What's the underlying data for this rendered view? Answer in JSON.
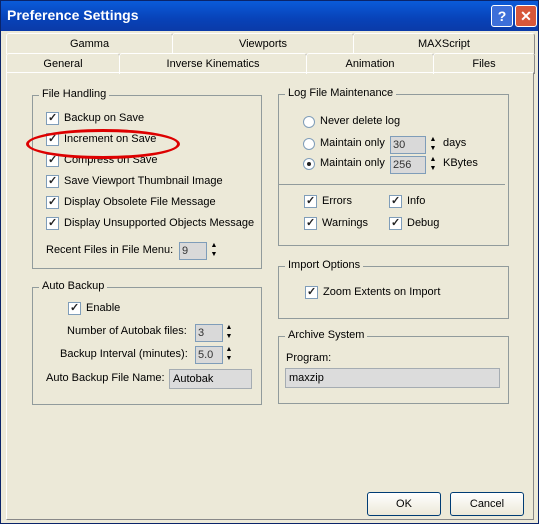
{
  "window": {
    "title": "Preference Settings"
  },
  "titlebar": {
    "help_label": "?",
    "close_label": "✕"
  },
  "tabs": {
    "row1": [
      "Gamma",
      "Viewports",
      "MAXScript"
    ],
    "row2": [
      "General",
      "Inverse Kinematics",
      "Animation",
      "Files"
    ],
    "active": "Files"
  },
  "file_handling": {
    "title": "File Handling",
    "items": [
      {
        "label": "Backup on Save",
        "checked": true
      },
      {
        "label": "Increment on Save",
        "checked": true
      },
      {
        "label": "Compress on Save",
        "checked": true
      },
      {
        "label": "Save Viewport Thumbnail Image",
        "checked": true
      },
      {
        "label": "Display Obsolete File Message",
        "checked": true
      },
      {
        "label": "Display Unsupported Objects Message",
        "checked": true
      }
    ],
    "recent_label": "Recent Files in File Menu:",
    "recent_value": "9"
  },
  "auto_backup": {
    "title": "Auto Backup",
    "enable_label": "Enable",
    "enable_checked": true,
    "num_files_label": "Number of Autobak files:",
    "num_files_value": "3",
    "interval_label": "Backup Interval (minutes):",
    "interval_value": "5.0",
    "name_label": "Auto Backup File Name:",
    "name_value": "Autobak"
  },
  "log_maintenance": {
    "title": "Log File Maintenance",
    "never_label": "Never delete log",
    "maintain_days_label": "Maintain only",
    "days_value": "30",
    "days_unit": "days",
    "maintain_kb_label": "Maintain only",
    "kb_value": "256",
    "kb_unit": "KBytes",
    "selected": "kbytes",
    "errors_label": "Errors",
    "info_label": "Info",
    "warnings_label": "Warnings",
    "debug_label": "Debug"
  },
  "import_options": {
    "title": "Import Options",
    "zoom_label": "Zoom Extents on Import",
    "zoom_checked": true
  },
  "archive": {
    "title": "Archive System",
    "program_label": "Program:",
    "program_value": "maxzip"
  },
  "buttons": {
    "ok": "OK",
    "cancel": "Cancel"
  },
  "colors": {
    "titlebar": "#0a5bd9",
    "highlight_ellipse": "#dd0000",
    "dialog_bg": "#ece9d8"
  }
}
